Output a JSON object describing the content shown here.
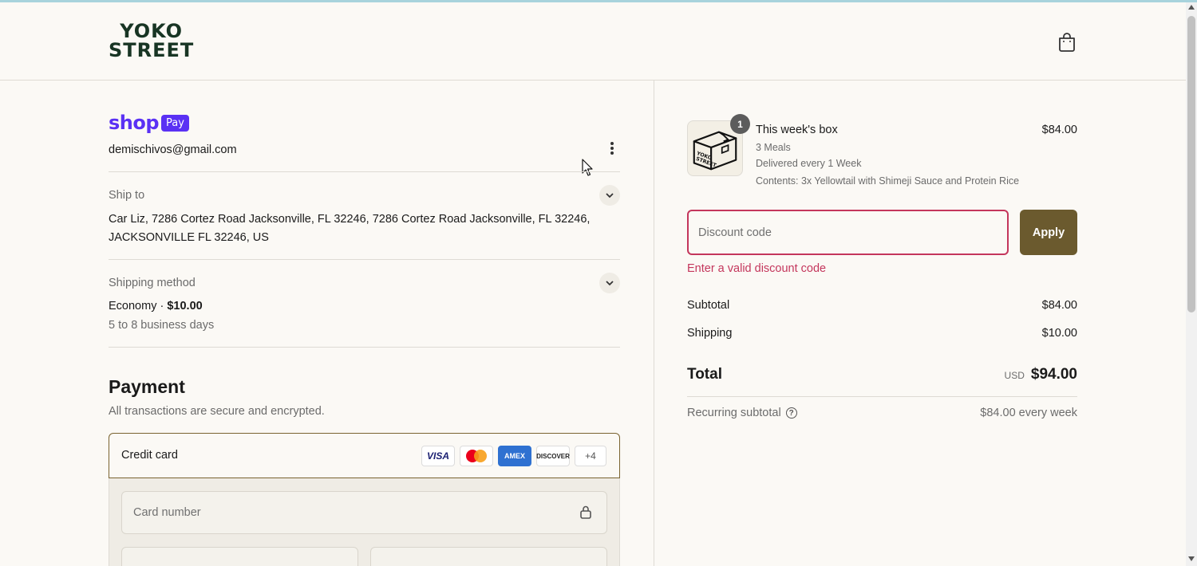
{
  "brand": {
    "line1": "YOKO",
    "line2": "STREET"
  },
  "shoppay": {
    "shop": "shop",
    "pay": "Pay",
    "email": "demischivos@gmail.com"
  },
  "ship_to": {
    "label": "Ship to",
    "address": "Car Liz, 7286 Cortez Road Jacksonville, FL 32246, 7286 Cortez Road Jacksonville, FL 32246, JACKSONVILLE FL 32246, US"
  },
  "shipping_method": {
    "label": "Shipping method",
    "name": "Economy",
    "separator": "·",
    "price": "$10.00",
    "days": "5 to 8 business days"
  },
  "payment": {
    "title": "Payment",
    "subtitle": "All transactions are secure and encrypted.",
    "method_label": "Credit card",
    "cards": {
      "visa": "VISA",
      "amex": "AMEX",
      "discover": "DISCOVER",
      "more": "+4"
    },
    "card_number_placeholder": "Card number"
  },
  "order": {
    "item": {
      "quantity": "1",
      "name": "This week's box",
      "price": "$84.00",
      "meals": "3 Meals",
      "delivery": "Delivered every 1 Week",
      "contents": "Contents: 3x Yellowtail with Shimeji Sauce and Protein Rice",
      "thumb_text": "YOKO STREET"
    },
    "discount": {
      "placeholder": "Discount code",
      "apply_label": "Apply",
      "error": "Enter a valid discount code"
    },
    "subtotal_label": "Subtotal",
    "subtotal_value": "$84.00",
    "shipping_label": "Shipping",
    "shipping_value": "$10.00",
    "total_label": "Total",
    "total_currency": "USD",
    "total_value": "$94.00",
    "recurring_label": "Recurring subtotal",
    "recurring_value": "$84.00 every week"
  },
  "colors": {
    "accent": "#6b5a2e",
    "error": "#c4365c",
    "shoppay": "#5a31f4",
    "brand": "#183524"
  }
}
